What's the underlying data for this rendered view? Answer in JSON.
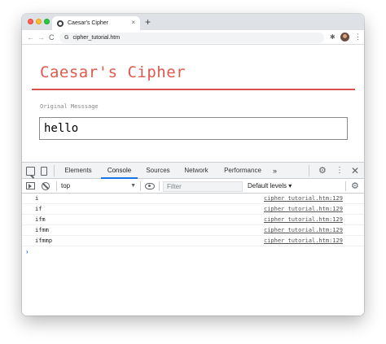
{
  "browser": {
    "tab_title": "Caesar's Cipher",
    "tab_close": "×",
    "new_tab": "+",
    "nav_back": "←",
    "nav_forward": "→",
    "nav_reload": "C",
    "omnibox_icon": "G",
    "url": "cipher_tutorial.htm",
    "extension_icon": "✱",
    "menu": "⋮"
  },
  "page": {
    "title": "Caesar's Cipher",
    "field_label": "Original Messsage",
    "message_value": "hello",
    "accent_color": "#e05a4e"
  },
  "devtools": {
    "tabs": [
      {
        "label": "Elements",
        "active": false
      },
      {
        "label": "Console",
        "active": true
      },
      {
        "label": "Sources",
        "active": false
      },
      {
        "label": "Network",
        "active": false
      },
      {
        "label": "Performance",
        "active": false
      }
    ],
    "more_tabs": "»",
    "settings_icon": "⚙",
    "menu": "⋮",
    "close": "✕",
    "console": {
      "context": "top",
      "context_arrow": "▼",
      "filter_placeholder": "Filter",
      "levels": "Default levels ▾",
      "settings_icon": "⚙",
      "prompt": "›",
      "messages": [
        {
          "text": "i",
          "source": "cipher_tutorial.htm:129"
        },
        {
          "text": "if",
          "source": "cipher_tutorial.htm:129"
        },
        {
          "text": "ifm",
          "source": "cipher_tutorial.htm:129"
        },
        {
          "text": "ifmm",
          "source": "cipher_tutorial.htm:129"
        },
        {
          "text": "ifmmp",
          "source": "cipher_tutorial.htm:129"
        }
      ]
    }
  }
}
